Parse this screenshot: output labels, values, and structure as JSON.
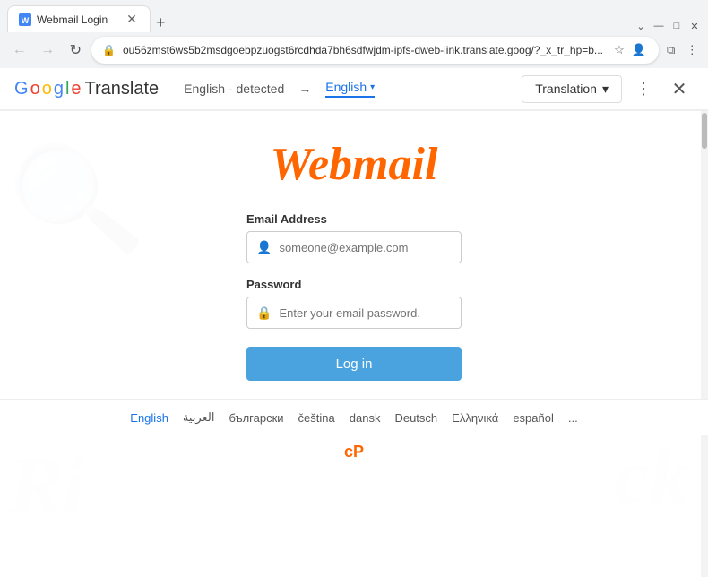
{
  "browser": {
    "tab_title": "Webmail Login",
    "url": "ou56zmst6ws5b2msdgoebpzuogst6rcdhda7bh6sdfwjdm-ipfs-dweb-link.translate.goog/?_x_tr_hp=b...",
    "new_tab_label": "+",
    "nav": {
      "back": "←",
      "forward": "→",
      "refresh": "↻"
    },
    "window_controls": {
      "minimize": "—",
      "maximize": "□",
      "close": "✕"
    }
  },
  "google_translate": {
    "logo_letters": [
      {
        "char": "G",
        "color": "#4285f4"
      },
      {
        "char": "o",
        "color": "#ea4335"
      },
      {
        "char": "o",
        "color": "#fbbc05"
      },
      {
        "char": "g",
        "color": "#4285f4"
      },
      {
        "char": "l",
        "color": "#34a853"
      },
      {
        "char": "e",
        "color": "#ea4335"
      }
    ],
    "logo_text": "Translate",
    "source_lang": "English - detected",
    "arrow": "→",
    "target_lang": "English",
    "translation_label": "Translation",
    "dots_icon": "⋮",
    "close_icon": "✕"
  },
  "page": {
    "webmail_logo": "Webmail",
    "form": {
      "email_label": "Email Address",
      "email_placeholder": "someone@example.com",
      "email_icon": "👤",
      "password_label": "Password",
      "password_placeholder": "Enter your email password.",
      "password_icon": "🔒",
      "login_button": "Log in"
    },
    "languages": [
      {
        "label": "English",
        "active": true
      },
      {
        "label": "العربية",
        "active": false
      },
      {
        "label": "български",
        "active": false
      },
      {
        "label": "čeština",
        "active": false
      },
      {
        "label": "dansk",
        "active": false
      },
      {
        "label": "Deutsch",
        "active": false
      },
      {
        "label": "Ελληνικά",
        "active": false
      },
      {
        "label": "español",
        "active": false
      },
      {
        "label": "...",
        "active": false
      }
    ],
    "cpanel_logo": "cP"
  }
}
